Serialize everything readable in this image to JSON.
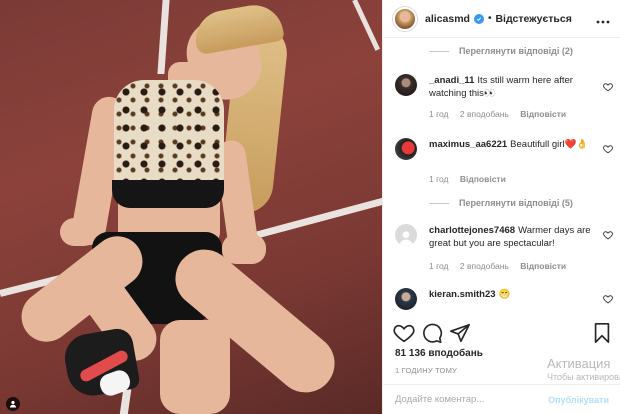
{
  "header": {
    "username": "alicasmd",
    "separator": "•",
    "follow_state": "Відстежується",
    "more_icon": "more-horizontal-icon"
  },
  "comments": {
    "view_replies_1": "Переглянути відповіді (2)",
    "items": [
      {
        "username": "_anadi_11",
        "text": "Its still warm here after watching this👀",
        "time": "1 год",
        "likes": "2 вподобань",
        "reply": "Відповісти"
      },
      {
        "username": "maximus_aa6221",
        "text": "Beautifull girl❤️👌",
        "time": "1 год",
        "likes": "",
        "reply": "Відповісти"
      },
      {
        "username": "charlottejones7468",
        "text": "Warmer days are great but you are spectacular!",
        "time": "1 год",
        "likes": "2 вподобань",
        "reply": "Відповісти"
      },
      {
        "username": "kieran.smith23",
        "text": "😁",
        "time": "",
        "likes": "",
        "reply": ""
      }
    ],
    "view_replies_2": "Переглянути відповіді (5)"
  },
  "post": {
    "likes": "81 136 вподобань",
    "posted": "1 ГОДИНУ ТОМУ"
  },
  "add_comment": {
    "placeholder": "Додайте коментар...",
    "publish": "Опублікувати"
  },
  "watermark": {
    "title": "Активация",
    "subtitle": "Чтобы активировать Windows, перейдите в раздел"
  },
  "colors": {
    "accent": "#3897f0",
    "text": "#262626",
    "muted": "#8e8e8e",
    "heart_red": "#ed4956"
  }
}
